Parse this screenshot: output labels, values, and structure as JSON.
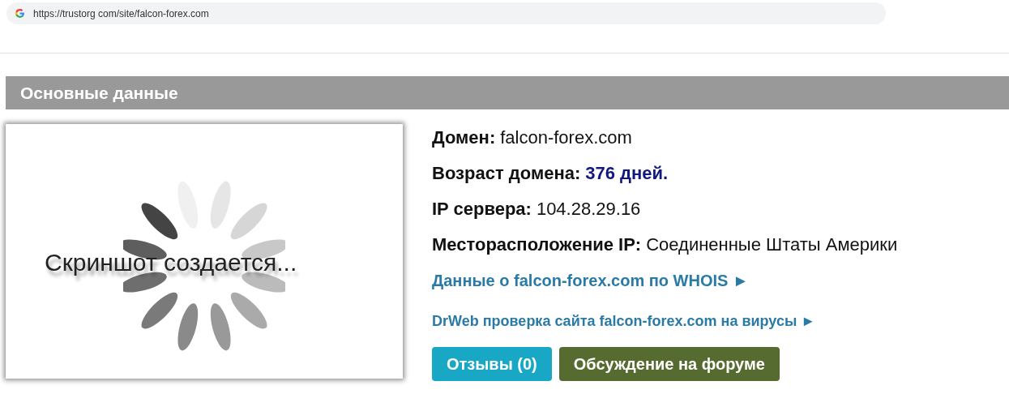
{
  "address_bar": {
    "url": "https://trustorg com/site/falcon-forex.com"
  },
  "section": {
    "title": "Основные данные"
  },
  "screenshot_placeholder": {
    "caption": "Скриншот создается..."
  },
  "fields": [
    {
      "label": "Домен:",
      "value": "falcon-forex.com",
      "kind": "plain"
    },
    {
      "label": "Возраст домена:",
      "value": "376 дней.",
      "kind": "highlight"
    },
    {
      "label": "IP сервера:",
      "value": "104.28.29.16",
      "kind": "plain"
    },
    {
      "label": "Месторасположение IP:",
      "value": "Соединенные Штаты Америки",
      "kind": "plain"
    }
  ],
  "links": [
    {
      "text": "Данные о falcon-forex.com по WHOIS ►",
      "kind": "large"
    },
    {
      "text": "DrWeb проверка сайта falcon-forex.com на вирусы ►",
      "kind": "small"
    }
  ],
  "buttons": [
    {
      "label": "Отзывы (0)",
      "kind": "info"
    },
    {
      "label": "Обсуждение на форуме",
      "kind": "forum"
    }
  ]
}
